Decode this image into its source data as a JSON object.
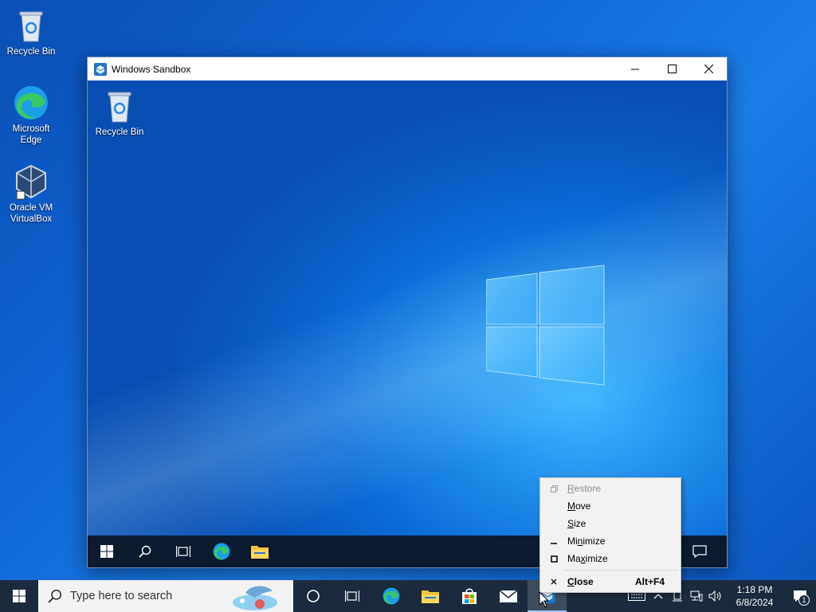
{
  "desktop": {
    "icons": [
      {
        "label": "Recycle Bin"
      },
      {
        "label": "Microsoft\nEdge"
      },
      {
        "label": "Oracle VM\nVirtualBox"
      }
    ]
  },
  "sandbox": {
    "title": "Windows Sandbox",
    "desktop_icon_label": "Recycle Bin"
  },
  "context_menu": {
    "items": [
      {
        "label": "Restore",
        "underline": "R",
        "rest": "estore",
        "disabled": true,
        "icon": "restore-icon"
      },
      {
        "label": "Move",
        "underline": "M",
        "rest": "ove",
        "disabled": false
      },
      {
        "label": "Size",
        "underline": "S",
        "rest": "ize",
        "disabled": false
      },
      {
        "label": "Minimize",
        "underline": "n",
        "disabled": false,
        "icon": "minimize-icon"
      },
      {
        "label": "Maximize",
        "underline": "x",
        "disabled": false,
        "icon": "maximize-icon"
      },
      {
        "label": "Close",
        "underline": "C",
        "rest": "lose",
        "shortcut": "Alt+F4",
        "disabled": false,
        "icon": "close-icon"
      }
    ]
  },
  "taskbar": {
    "search_placeholder": "Type here to search",
    "time": "1:18 PM",
    "date": "6/8/2024",
    "notification_count": "1"
  }
}
